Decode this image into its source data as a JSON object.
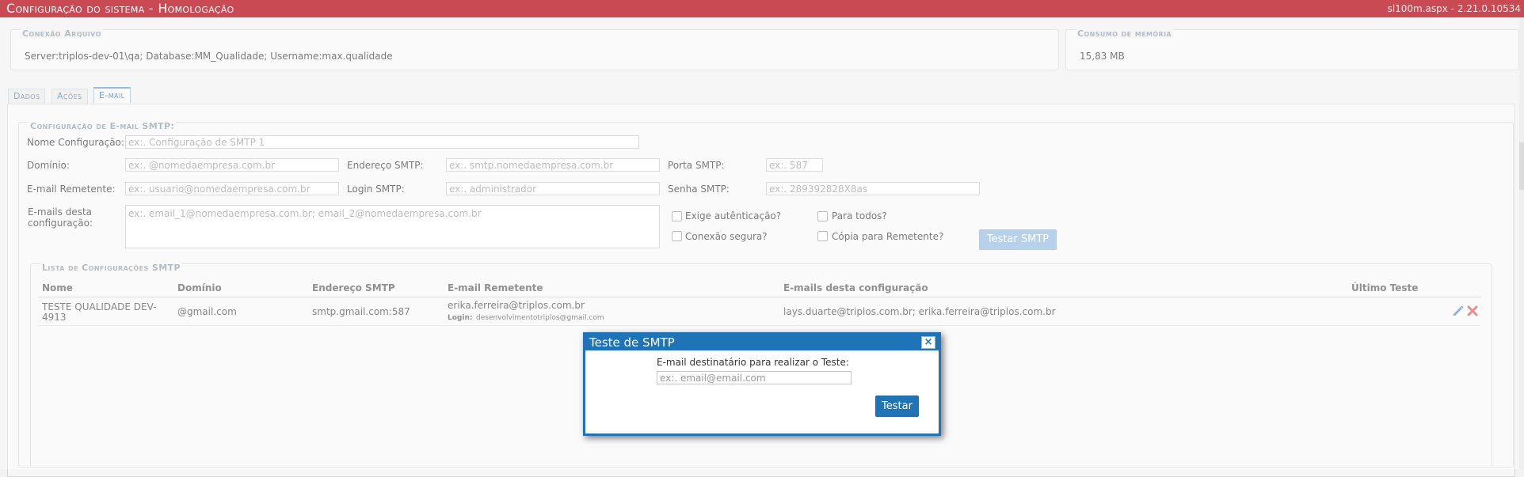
{
  "header": {
    "title": "Configuração do sistema  - Homologação",
    "version": "sl100m.aspx - 2.21.0.10534"
  },
  "connection": {
    "legend": "Conexão Arquivo",
    "text": "Server:triplos-dev-01\\qa; Database:MM_Qualidade; Username:max.qualidade"
  },
  "memory": {
    "legend": "Consumo de memória",
    "value": "15,83 MB"
  },
  "tabs": [
    {
      "label": "Dados"
    },
    {
      "label": "Ações"
    },
    {
      "label": "E-mail"
    }
  ],
  "smtp": {
    "legend": "Configuração de E-mail SMTP:",
    "name_label": "Nome Configuração:",
    "name_placeholder": "ex:. Configuração de SMTP 1",
    "domain_label": "Domínio:",
    "domain_placeholder": "ex:. @nomedaempresa.com.br",
    "address_label": "Endereço SMTP:",
    "address_placeholder": "ex:. smtp.nomedaempresa.com.br",
    "port_label": "Porta SMTP:",
    "port_placeholder": "ex:. 587",
    "sender_label": "E-mail Remetente:",
    "sender_placeholder": "ex:. usuario@nomedaempresa.com.br",
    "login_label": "Login SMTP:",
    "login_placeholder": "ex:. administrador",
    "password_label": "Senha SMTP:",
    "password_placeholder": "ex:. 289392828X8as",
    "emails_label_1": "E-mails desta",
    "emails_label_2": "configuração:",
    "emails_placeholder": "ex:. email_1@nomedaempresa.com.br; email_2@nomedaempresa.com.br",
    "auth_label": "Exige autênticação?",
    "secure_label": "Conexão segura?",
    "all_label": "Para todos?",
    "copy_label": "Cópia para Remetente?",
    "test_button": "Testar SMTP"
  },
  "list": {
    "legend": "Lista de Configurações SMTP",
    "columns": [
      "Nome",
      "Domínio",
      "Endereço SMTP",
      "E-mail Remetente",
      "E-mails desta configuração",
      "Último Teste"
    ],
    "rows": [
      {
        "name_1": "TESTE QUALIDADE DEV-",
        "name_2": "4913",
        "domain": "@gmail.com",
        "address": "smtp.gmail.com:587",
        "sender": "erika.ferreira@triplos.com.br",
        "login_label": "Login:",
        "login_value": "desenvolvimentotriplos@gmail.com",
        "emails": "lays.duarte@triplos.com.br; erika.ferreira@triplos.com.br",
        "last_test": ""
      }
    ]
  },
  "dialog": {
    "title": "Teste de SMTP",
    "close": "×",
    "prompt": "E-mail destinatário para realizar o Teste:",
    "input_placeholder": "ex:. email@email.com",
    "button": "Testar"
  },
  "colors": {
    "header_bg": "#c94a52",
    "dialog_accent": "#1f73b7",
    "button_blue": "#2f7fc1",
    "delete_red": "#d9534f"
  }
}
